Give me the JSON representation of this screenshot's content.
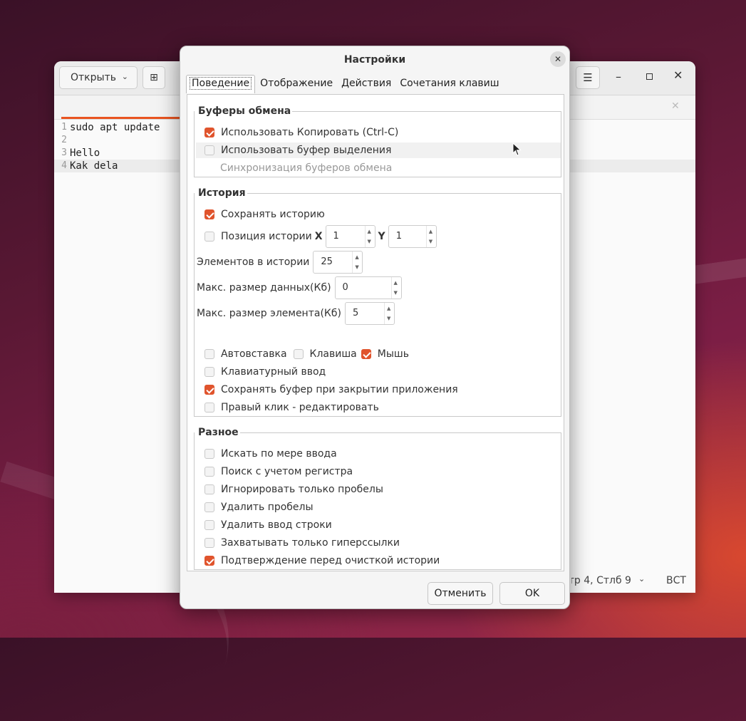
{
  "editor": {
    "open_label": "Открыть",
    "lines": [
      {
        "num": "1",
        "text": "sudo apt update"
      },
      {
        "num": "2",
        "text": ""
      },
      {
        "num": "3",
        "text": "Hello"
      },
      {
        "num": "4",
        "text": "Kak dela"
      }
    ],
    "status_position": "Стр 4, Стлб 9",
    "status_mode": "ВСТ"
  },
  "dialog": {
    "title": "Настройки",
    "tabs": [
      "Поведение",
      "Отображение",
      "Действия",
      "Сочетания клавиш"
    ],
    "clipboard": {
      "title": "Буферы обмена",
      "use_copy": "Использовать Копировать (Ctrl-C)",
      "use_selection": "Использовать буфер выделения",
      "sync": "Синхронизация буферов обмена"
    },
    "history": {
      "title": "История",
      "save_history": "Сохранять историю",
      "position": "Позиция истории",
      "x_label": "X",
      "x_value": "1",
      "y_label": "Y",
      "y_value": "1",
      "items_label": "Элементов в истории",
      "items_value": "25",
      "max_data_label": "Макс. размер данных(Кб)",
      "max_data_value": "0",
      "max_item_label": "Макс. размер элемента(Кб)",
      "max_item_value": "5",
      "autopaste": "Автовставка",
      "key": "Клавиша",
      "mouse": "Мышь",
      "keyboard_input": "Клавиатурный ввод",
      "save_on_close": "Сохранять буфер при закрытии приложения",
      "right_click_edit": "Правый клик - редактировать"
    },
    "misc": {
      "title": "Разное",
      "search_as_type": "Искать по мере ввода",
      "case_sensitive": "Поиск с учетом регистра",
      "ignore_spaces": "Игнорировать только пробелы",
      "trim_spaces": "Удалить пробелы",
      "remove_newline": "Удалить ввод строки",
      "only_links": "Захватывать только гиперссылки",
      "confirm_clear": "Подтверждение перед очисткой истории"
    },
    "cancel_label": "Отменить",
    "ok_label": "OK"
  }
}
